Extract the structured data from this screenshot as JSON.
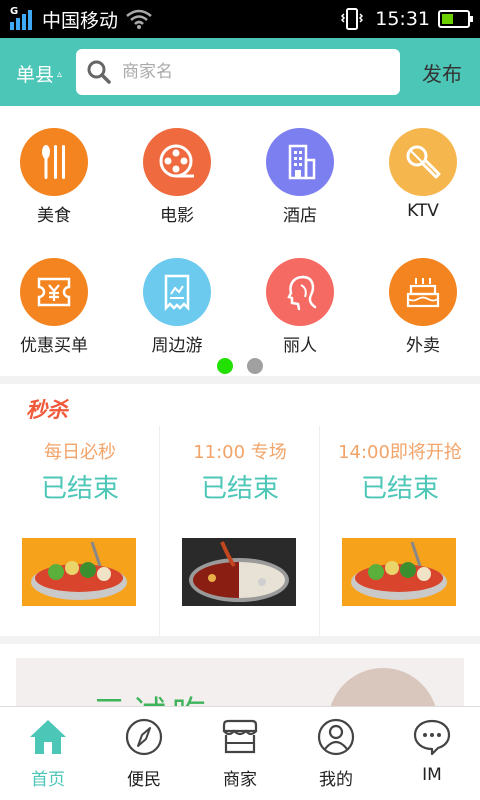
{
  "status_bar": {
    "carrier": "中国移动",
    "network_type": "G",
    "time": "15:31"
  },
  "header": {
    "city": "单县",
    "city_caret": "▵",
    "search_placeholder": "商家名",
    "publish_label": "发布"
  },
  "categories": [
    {
      "label": "美食",
      "icon": "fork-knife-icon",
      "color": "#f4841f"
    },
    {
      "label": "电影",
      "icon": "film-reel-icon",
      "color": "#ef6a3f"
    },
    {
      "label": "酒店",
      "icon": "building-icon",
      "color": "#7b7ff0"
    },
    {
      "label": "KTV",
      "icon": "microphone-icon",
      "color": "#f5b64e"
    },
    {
      "label": "优惠买单",
      "icon": "coupon-icon",
      "color": "#f4841f"
    },
    {
      "label": "周边游",
      "icon": "ticket-icon",
      "color": "#6ccaee"
    },
    {
      "label": "丽人",
      "icon": "lady-profile-icon",
      "color": "#f56b63"
    },
    {
      "label": "外卖",
      "icon": "cake-icon",
      "color": "#f4841f"
    }
  ],
  "pager": {
    "active_color": "#22e000",
    "inactive_color": "#a0a0a0"
  },
  "seckill": {
    "title": "秒杀",
    "slots": [
      {
        "time": "每日必秒",
        "status": "已结束"
      },
      {
        "time": "11:00 专场",
        "status": "已结束"
      },
      {
        "time": "14:00即将开抢",
        "status": "已结束"
      }
    ]
  },
  "banner": {
    "text": "一元试吃"
  },
  "bottom_nav": [
    {
      "label": "首页",
      "icon": "home-icon",
      "active": true
    },
    {
      "label": "便民",
      "icon": "compass-icon",
      "active": false
    },
    {
      "label": "商家",
      "icon": "shop-icon",
      "active": false
    },
    {
      "label": "我的",
      "icon": "user-icon",
      "active": false
    },
    {
      "label": "IM",
      "icon": "chat-icon",
      "active": false
    }
  ],
  "colors": {
    "accent": "#4cc6b7",
    "seckill_title": "#f05a3a",
    "seckill_time": "#f2a46a"
  }
}
